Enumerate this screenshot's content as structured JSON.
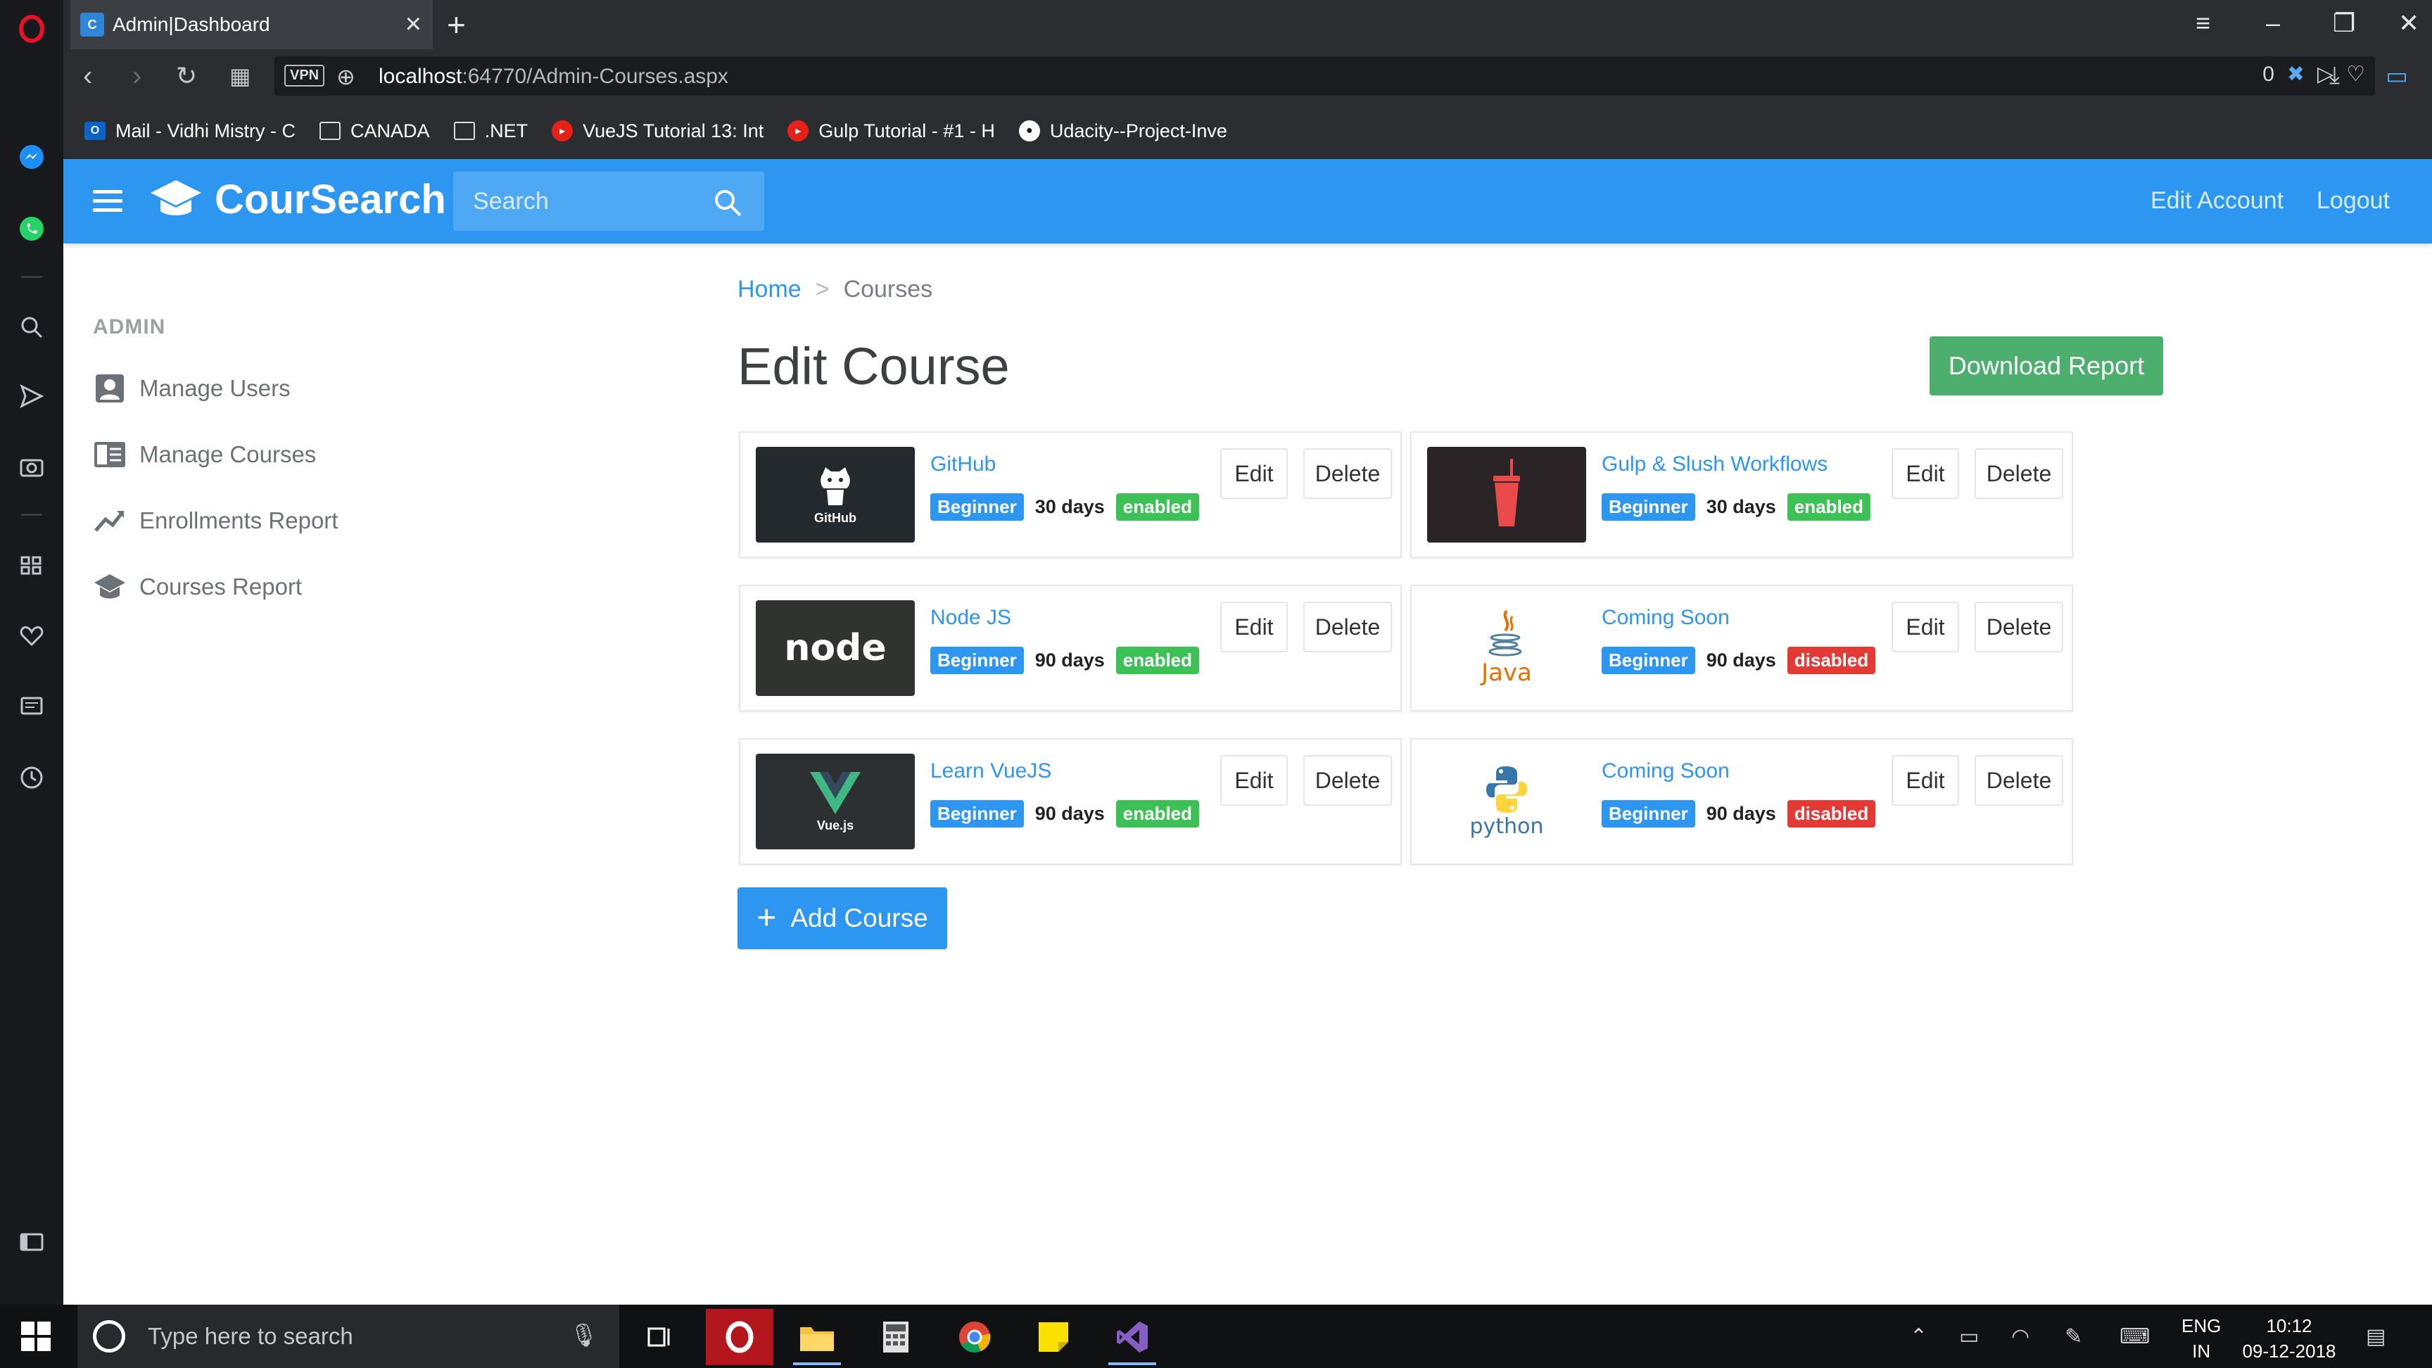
{
  "browser": {
    "tab_title": "Admin|Dashboard",
    "url_host": "localhost",
    "url_path": ":64770/Admin-Courses.aspx",
    "vpn_label": "VPN",
    "blocker_count": "0",
    "bookmarks": [
      {
        "label": "Mail - Vidhi Mistry - C",
        "icon": "outlook-icon"
      },
      {
        "label": "CANADA",
        "icon": "folder-icon"
      },
      {
        "label": ".NET",
        "icon": "folder-icon"
      },
      {
        "label": "VueJS Tutorial 13: Int",
        "icon": "youtube-icon"
      },
      {
        "label": "Gulp Tutorial - #1 - H",
        "icon": "youtube-icon"
      },
      {
        "label": "Udacity--Project-Inve",
        "icon": "github-icon"
      }
    ]
  },
  "navbar": {
    "brand": "CourSearch",
    "search_placeholder": "Search",
    "edit_account": "Edit Account",
    "logout": "Logout"
  },
  "sidebar": {
    "heading": "ADMIN",
    "items": [
      {
        "label": "Manage Users",
        "icon": "user-icon"
      },
      {
        "label": "Manage Courses",
        "icon": "courses-icon"
      },
      {
        "label": "Enrollments Report",
        "icon": "trend-icon"
      },
      {
        "label": "Courses Report",
        "icon": "graduation-cap-icon"
      }
    ]
  },
  "breadcrumb": {
    "home": "Home",
    "separator": ">",
    "current": "Courses"
  },
  "page": {
    "title": "Edit Course",
    "download_report": "Download Report",
    "add_course": "Add Course"
  },
  "course_actions": {
    "edit": "Edit",
    "delete": "Delete"
  },
  "courses": [
    {
      "title": "GitHub",
      "level": "Beginner",
      "duration": "30 days",
      "status": "enabled",
      "thumb_label": "GitHub"
    },
    {
      "title": "Gulp & Slush Workflows",
      "level": "Beginner",
      "duration": "30 days",
      "status": "enabled",
      "thumb_label": ""
    },
    {
      "title": "Node JS",
      "level": "Beginner",
      "duration": "90 days",
      "status": "enabled",
      "thumb_label": "node"
    },
    {
      "title": "Coming Soon",
      "level": "Beginner",
      "duration": "90 days",
      "status": "disabled",
      "thumb_label": "Java"
    },
    {
      "title": "Learn VueJS",
      "level": "Beginner",
      "duration": "90 days",
      "status": "enabled",
      "thumb_label": "Vue.js"
    },
    {
      "title": "Coming Soon",
      "level": "Beginner",
      "duration": "90 days",
      "status": "disabled",
      "thumb_label": "python"
    }
  ],
  "taskbar": {
    "search_placeholder": "Type here to search",
    "lang_top": "ENG",
    "lang_bottom": "IN",
    "time": "10:12",
    "date": "09-12-2018"
  },
  "colors": {
    "primary": "#2d96f0",
    "success": "#4caf6e",
    "enabled_badge": "#3dc157",
    "disabled_badge": "#e53935",
    "browser_chrome": "#2b2d31"
  }
}
